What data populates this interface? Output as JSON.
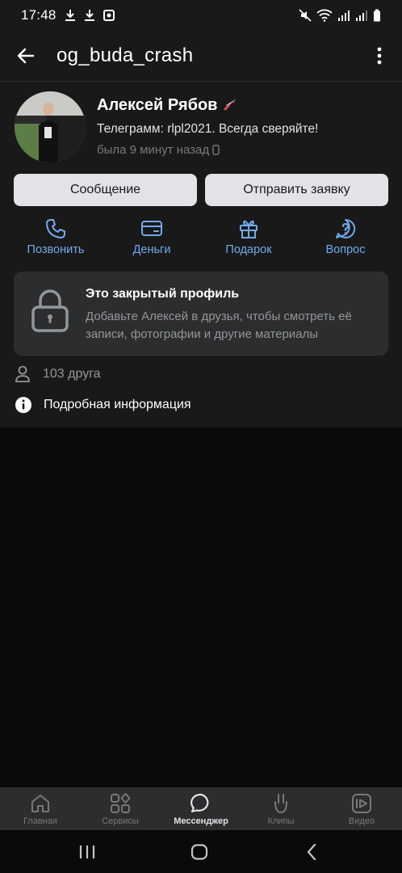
{
  "statusbar": {
    "time": "17:48"
  },
  "header": {
    "title": "og_buda_crash"
  },
  "profile": {
    "name": "Алексей Рябов",
    "status": "Телеграмм: rlpl2021. Всегда сверяйте!",
    "seen": "была 9 минут назад"
  },
  "buttons": {
    "message": "Сообщение",
    "request": "Отправить заявку"
  },
  "actions": {
    "call": "Позвонить",
    "money": "Деньги",
    "gift": "Подарок",
    "question": "Вопрос"
  },
  "closed": {
    "title": "Это закрытый профиль",
    "text": "Добавьте Алексей в друзья, чтобы смотреть её записи, фотографии и другие материалы"
  },
  "friends": {
    "label": "103 друга"
  },
  "details": {
    "label": "Подробная информация"
  },
  "tabs": {
    "home": "Главная",
    "services": "Сервисы",
    "messenger": "Мессенджер",
    "clips": "Клипы",
    "video": "Видео"
  },
  "colors": {
    "accent": "#71aaeb",
    "background": "#19191a",
    "card": "#2c2d2e"
  }
}
